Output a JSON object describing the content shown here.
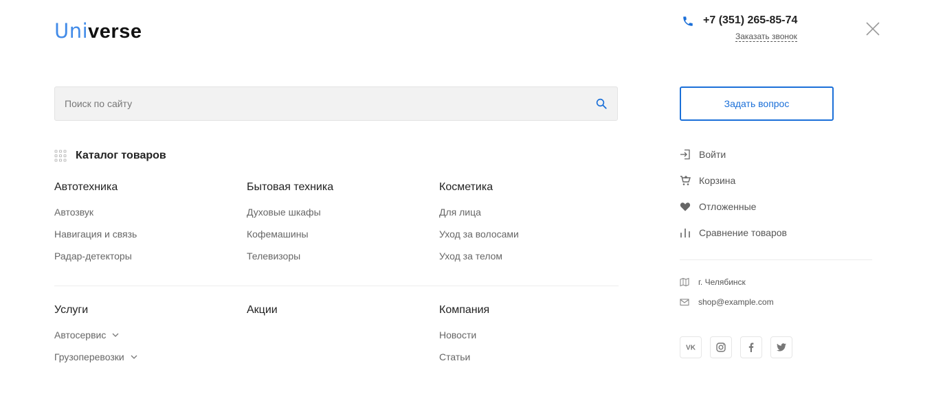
{
  "logo": {
    "part1": "Uni",
    "part2": "verse"
  },
  "header": {
    "phone": "+7 (351) 265-85-74",
    "callback_label": "Заказать звонок"
  },
  "search": {
    "placeholder": "Поиск по сайту",
    "value": ""
  },
  "ask_button": "Задать вопрос",
  "catalog_title": "Каталог товаров",
  "categories": [
    {
      "title": "Автотехника",
      "items": [
        "Автозвук",
        "Навигация и связь",
        "Радар-детекторы"
      ]
    },
    {
      "title": "Бытовая техника",
      "items": [
        "Духовые шкафы",
        "Кофемашины",
        "Телевизоры"
      ]
    },
    {
      "title": "Косметика",
      "items": [
        "Для лица",
        "Уход за волосами",
        "Уход за телом"
      ]
    }
  ],
  "sections": [
    {
      "title": "Услуги",
      "items": [
        "Автосервис",
        "Грузоперевозки"
      ]
    },
    {
      "title": "Акции",
      "items": []
    },
    {
      "title": "Компания",
      "items": [
        "Новости",
        "Статьи"
      ]
    }
  ],
  "user_menu": [
    {
      "label": "Войти",
      "icon": "login-icon"
    },
    {
      "label": "Корзина",
      "icon": "cart-icon"
    },
    {
      "label": "Отложенные",
      "icon": "heart-icon"
    },
    {
      "label": "Сравнение товаров",
      "icon": "compare-icon"
    }
  ],
  "contacts": {
    "city": "г. Челябинск",
    "email": "shop@example.com"
  },
  "socials": [
    "vk-icon",
    "instagram-icon",
    "facebook-icon",
    "twitter-icon"
  ],
  "colors": {
    "accent": "#1a6fd8",
    "text": "#333333",
    "muted": "#666666"
  }
}
